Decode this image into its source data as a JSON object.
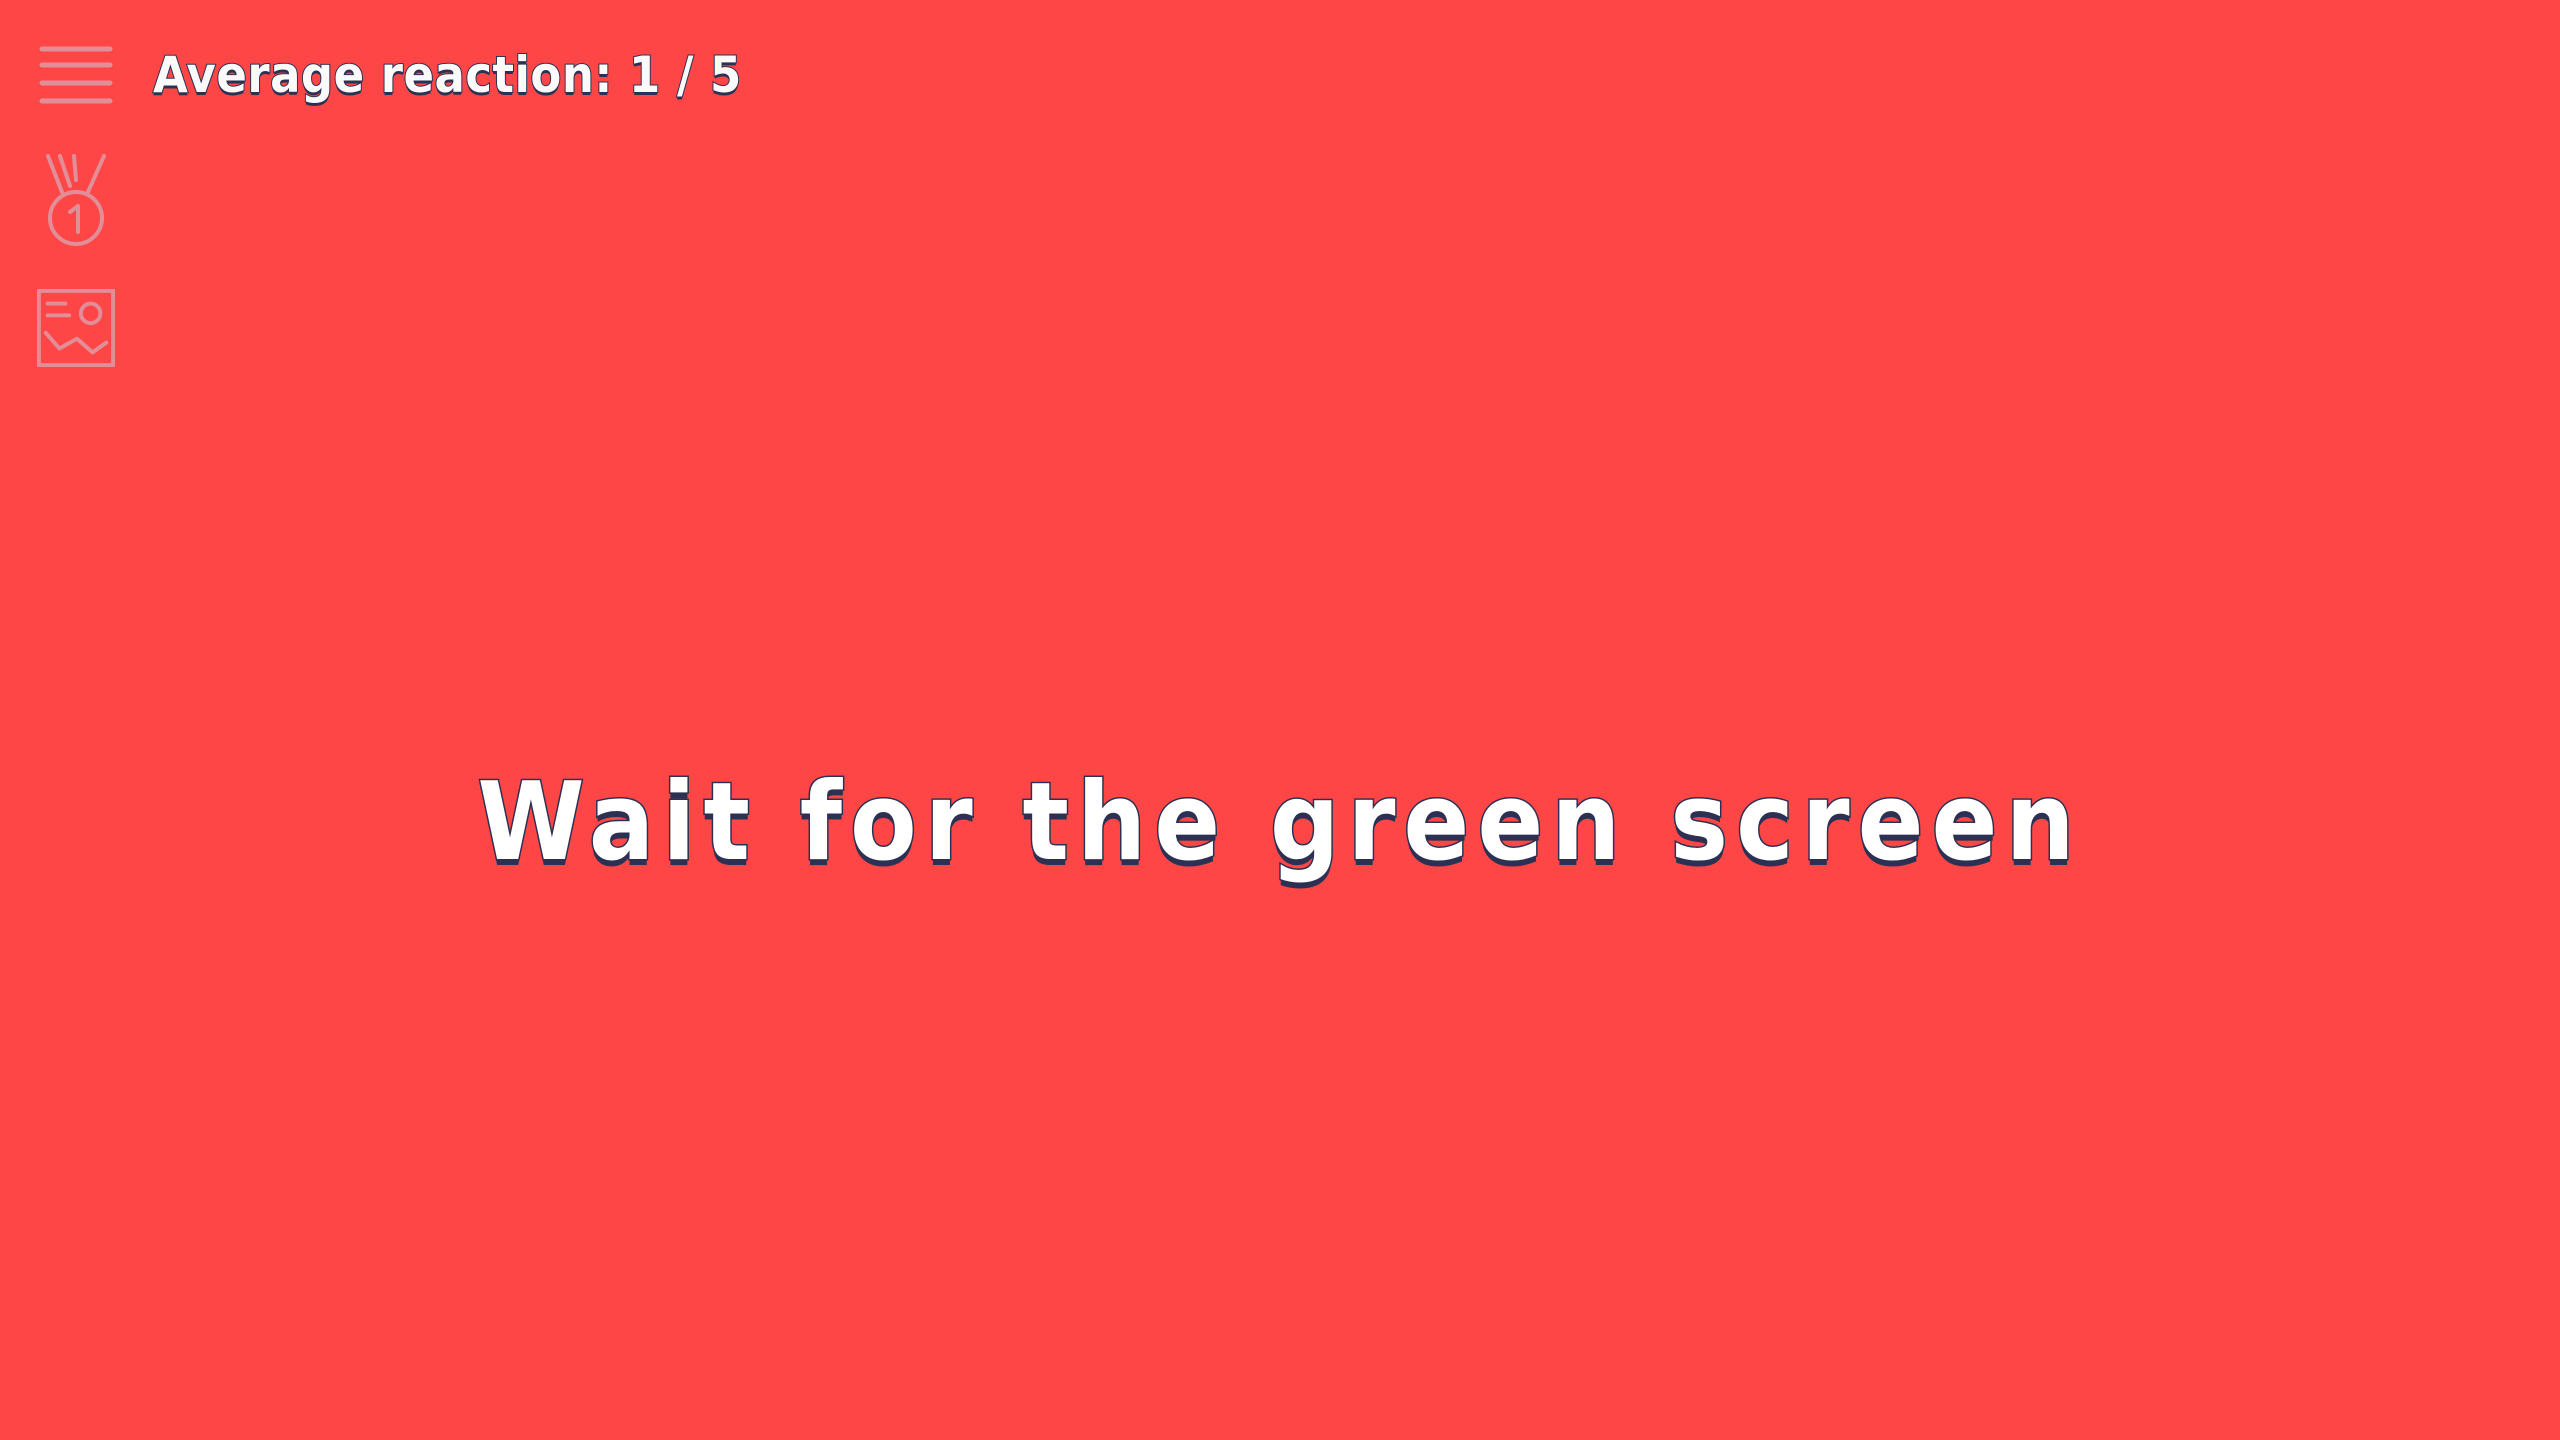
{
  "game": {
    "score_text": "Average reaction: 1 / 5",
    "message": "Wait for the green screen",
    "background_color": "#ff4646",
    "outline_color": "#2c3153"
  },
  "sidebar": {
    "items": [
      {
        "icon": "menu-icon"
      },
      {
        "icon": "medal-icon"
      },
      {
        "icon": "stats-image-icon"
      }
    ]
  }
}
